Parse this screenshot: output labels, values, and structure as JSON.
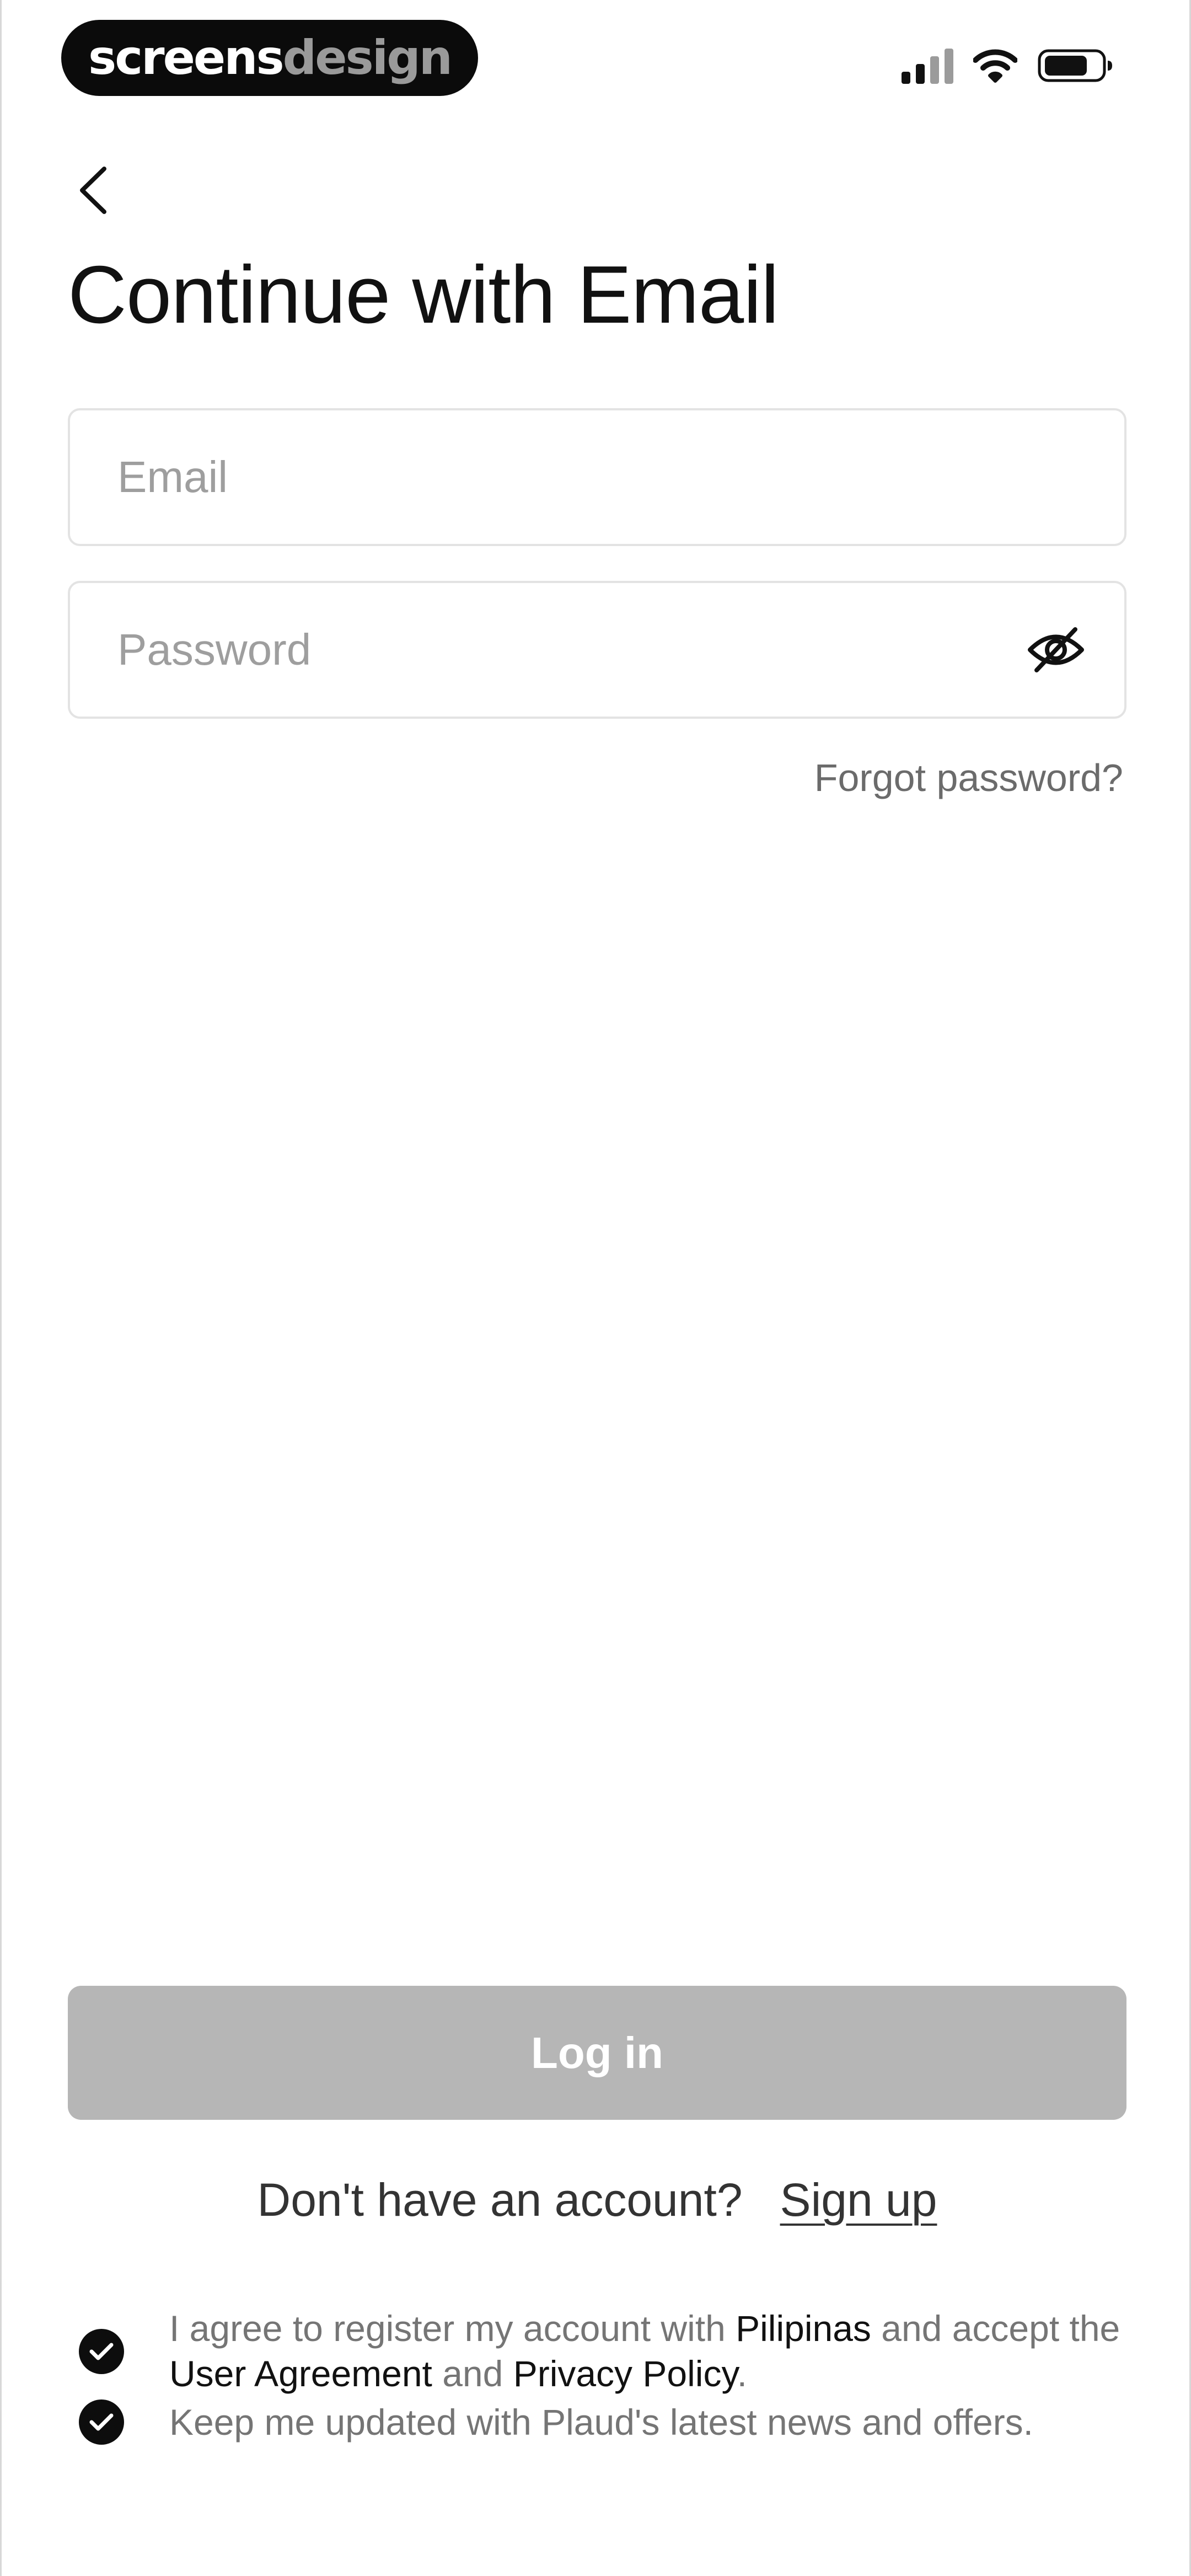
{
  "status_bar": {
    "brand_part1": "screens",
    "brand_part2": "design",
    "icons": [
      "signal-icon",
      "wifi-icon",
      "battery-icon"
    ]
  },
  "header": {
    "back_icon": "chevron-left-icon",
    "title": "Continue with Email"
  },
  "form": {
    "email_placeholder": "Email",
    "email_value": "",
    "password_placeholder": "Password",
    "password_value": "",
    "password_toggle_icon": "eye-off-icon",
    "forgot_label": "Forgot password?"
  },
  "actions": {
    "login_label": "Log in",
    "signup_prompt": "Don't have an account?",
    "signup_label": "Sign up"
  },
  "consents": {
    "agree_part1": "I agree to register my account with ",
    "agree_brand": "Pilipinas",
    "agree_part2": " and accept the ",
    "user_agreement": "User Agreement",
    "agree_and": " and ",
    "privacy_policy": "Privacy Policy",
    "agree_period": ".",
    "newsletter": "Keep me updated with Plaud's latest news and offers.",
    "agree_checked": true,
    "newsletter_checked": true
  },
  "colors": {
    "accent": "#111111",
    "disabled_button": "#b6b6b6",
    "muted_text": "#757575",
    "field_border": "#e3e3e3",
    "placeholder": "#9e9e9e"
  }
}
